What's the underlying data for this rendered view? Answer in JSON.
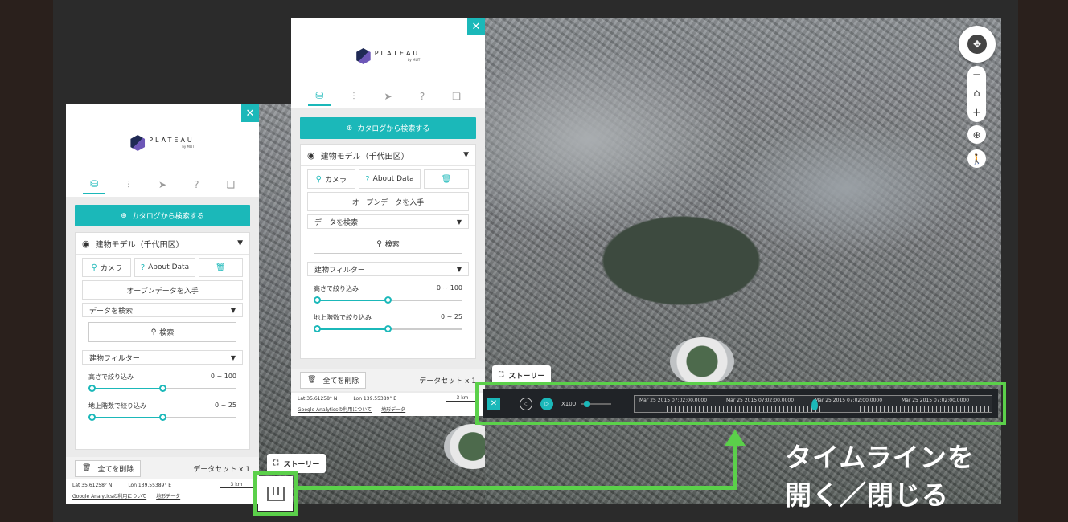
{
  "logo": {
    "name": "PLATEAU",
    "sub": "by MLIT"
  },
  "panel": {
    "close": "✕",
    "catalog_button": "カタログから検索する",
    "dataset_title": "建物モデル（千代田区）",
    "camera_label": "カメラ",
    "about_label": "About Data",
    "open_data_label": "オープンデータを入手",
    "data_search_section": "データを検索",
    "search_button": "検索",
    "building_filter_section": "建物フィルター",
    "height_filter_label": "高さで絞り込み",
    "height_filter_range": "0 ~ 100",
    "floors_filter_label": "地上階数で絞り込み",
    "floors_filter_range": "0 ~ 25",
    "delete_all_label": "全てを削除",
    "dataset_count": "データセット x 1"
  },
  "status": {
    "lat": "Lat  35.61258° N",
    "lon": "Lon  139.55389° E",
    "scale": "3 km",
    "analytics_link": "Google Analyticsの利用について",
    "terrain_link": "地形データ"
  },
  "story_label": "ストーリー",
  "timeline": {
    "close": "✕",
    "speed": "X100",
    "labels": [
      "Mar 25 2015 07:02:00.0000",
      "Mar 25 2015 07:02:00.0000",
      "Mar 25 2015 07:02:00.0000",
      "Mar 25 2015 07:02:00.0000"
    ]
  },
  "caption": {
    "line1": "タイムラインを",
    "line2": "開く／閉じる"
  },
  "colors": {
    "accent": "#1bb8b9",
    "annotation": "#5bd04a"
  },
  "icons": {
    "tabs": [
      "database-icon",
      "sliders-icon",
      "send-icon",
      "help-icon",
      "chat-icon"
    ],
    "map_controls": [
      "compass-icon",
      "zoom-out-icon",
      "home-icon",
      "zoom-in-icon",
      "locate-icon",
      "pedestrian-icon"
    ]
  }
}
